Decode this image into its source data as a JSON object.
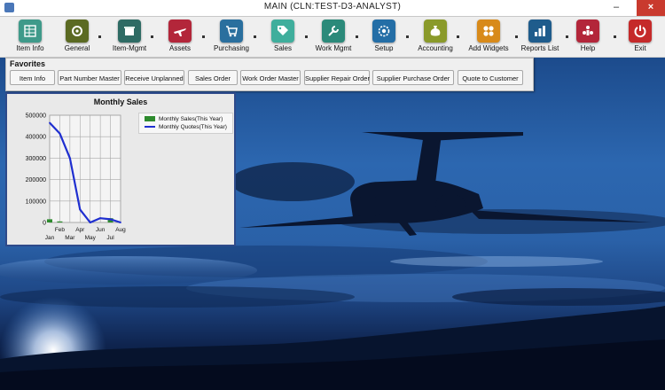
{
  "window": {
    "title": "MAIN  (CLN:TEST-D3-ANALYST)",
    "min_glyph": "–",
    "max_glyph": "□",
    "close_glyph": "×"
  },
  "toolbar": {
    "items": [
      {
        "label": "Item Info",
        "icon": "table-icon",
        "color": "#3f9a8a"
      },
      {
        "label": "General",
        "icon": "gear-cog-icon",
        "color": "#5b6a22"
      },
      {
        "label": "Item-Mgmt",
        "icon": "box-icon",
        "color": "#2e6b64"
      },
      {
        "label": "Assets",
        "icon": "airplane-icon",
        "color": "#b3263a"
      },
      {
        "label": "Purchasing",
        "icon": "cart-icon",
        "color": "#2a6f9e"
      },
      {
        "label": "Sales",
        "icon": "tag-icon",
        "color": "#3fae9c"
      },
      {
        "label": "Work Mgmt",
        "icon": "wrench-icon",
        "color": "#2b8a7a"
      },
      {
        "label": "Setup",
        "icon": "settings-icon",
        "color": "#246ea6"
      },
      {
        "label": "Accounting",
        "icon": "money-bag-icon",
        "color": "#8a9a2a"
      },
      {
        "label": "Add Widgets",
        "icon": "widgets-icon",
        "color": "#d88a1a"
      },
      {
        "label": "Reports List",
        "icon": "bar-report-icon",
        "color": "#1f5c8c"
      },
      {
        "label": "Help",
        "icon": "people-icon",
        "color": "#b3263a"
      },
      {
        "label": "Exit",
        "icon": "power-icon",
        "color": "#c52a2a"
      }
    ]
  },
  "favorites": {
    "title": "Favorites",
    "buttons": [
      "Item Info",
      "Part Number Master",
      "Receive Unplanned",
      "Sales Order",
      "Work Order Master",
      "Supplier Repair Order",
      "Supplier Purchase Order",
      "Quote to Customer"
    ]
  },
  "chart_data": {
    "type": "line",
    "title": "Monthly Sales",
    "categories": [
      "Jan",
      "Feb",
      "Mar",
      "Apr",
      "May",
      "Jun",
      "Jul",
      "Aug"
    ],
    "yticks": [
      0,
      100000,
      200000,
      300000,
      400000,
      500000
    ],
    "ytick_labels": [
      "0",
      "100000",
      "200000",
      "300000",
      "400000",
      "500000"
    ],
    "ylim": [
      0,
      500000
    ],
    "grid": true,
    "legend_position": "top-right",
    "series": [
      {
        "name": "Monthly Sales(This Year)",
        "kind": "bar",
        "color": "#2e8b2e",
        "values": [
          15000,
          5000,
          0,
          0,
          0,
          0,
          20000,
          0
        ]
      },
      {
        "name": "Monthly Quotes(This Year)",
        "kind": "line",
        "color": "#1f2fd0",
        "values": [
          465000,
          415000,
          300000,
          60000,
          0,
          20000,
          15000,
          0
        ]
      }
    ]
  }
}
